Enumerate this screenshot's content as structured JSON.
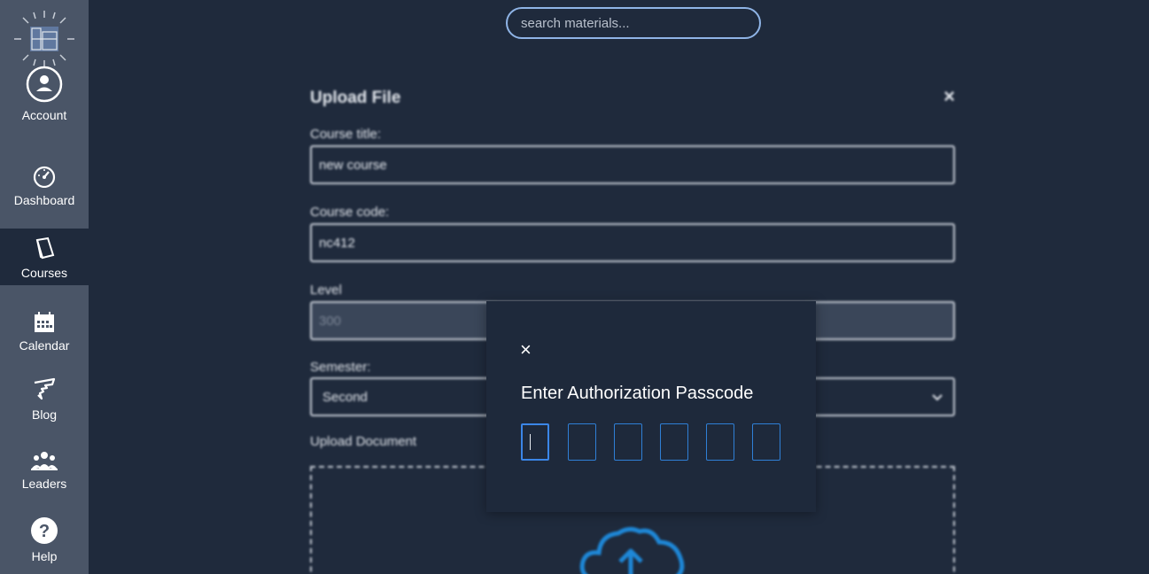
{
  "search": {
    "placeholder": "search materials..."
  },
  "sidebar": {
    "items": [
      {
        "label": "Account",
        "icon": "account-icon"
      },
      {
        "label": "Dashboard",
        "icon": "dashboard-icon"
      },
      {
        "label": "Courses",
        "icon": "book-icon",
        "active": true
      },
      {
        "label": "Calendar",
        "icon": "calendar-icon"
      },
      {
        "label": "Blog",
        "icon": "blog-icon"
      },
      {
        "label": "Leaders",
        "icon": "leaders-icon"
      },
      {
        "label": "Help",
        "icon": "help-icon"
      }
    ]
  },
  "upload_form": {
    "title": "Upload File",
    "close": "×",
    "course_title_label": "Course title:",
    "course_title_value": "new course",
    "course_code_label": "Course code:",
    "course_code_value": "nc412",
    "level_label": "Level",
    "level_value": "300",
    "semester_label": "Semester:",
    "semester_value": "Second",
    "upload_label": "Upload Document",
    "upload_icon": "cloud-upload-icon"
  },
  "modal": {
    "close": "×",
    "title": "Enter Authorization Passcode",
    "code_digits": [
      "",
      "",
      "",
      "",
      "",
      ""
    ]
  },
  "colors": {
    "background": "#1f2a3c",
    "sidebar": "#4a5567",
    "accent": "#2f7fd6"
  }
}
